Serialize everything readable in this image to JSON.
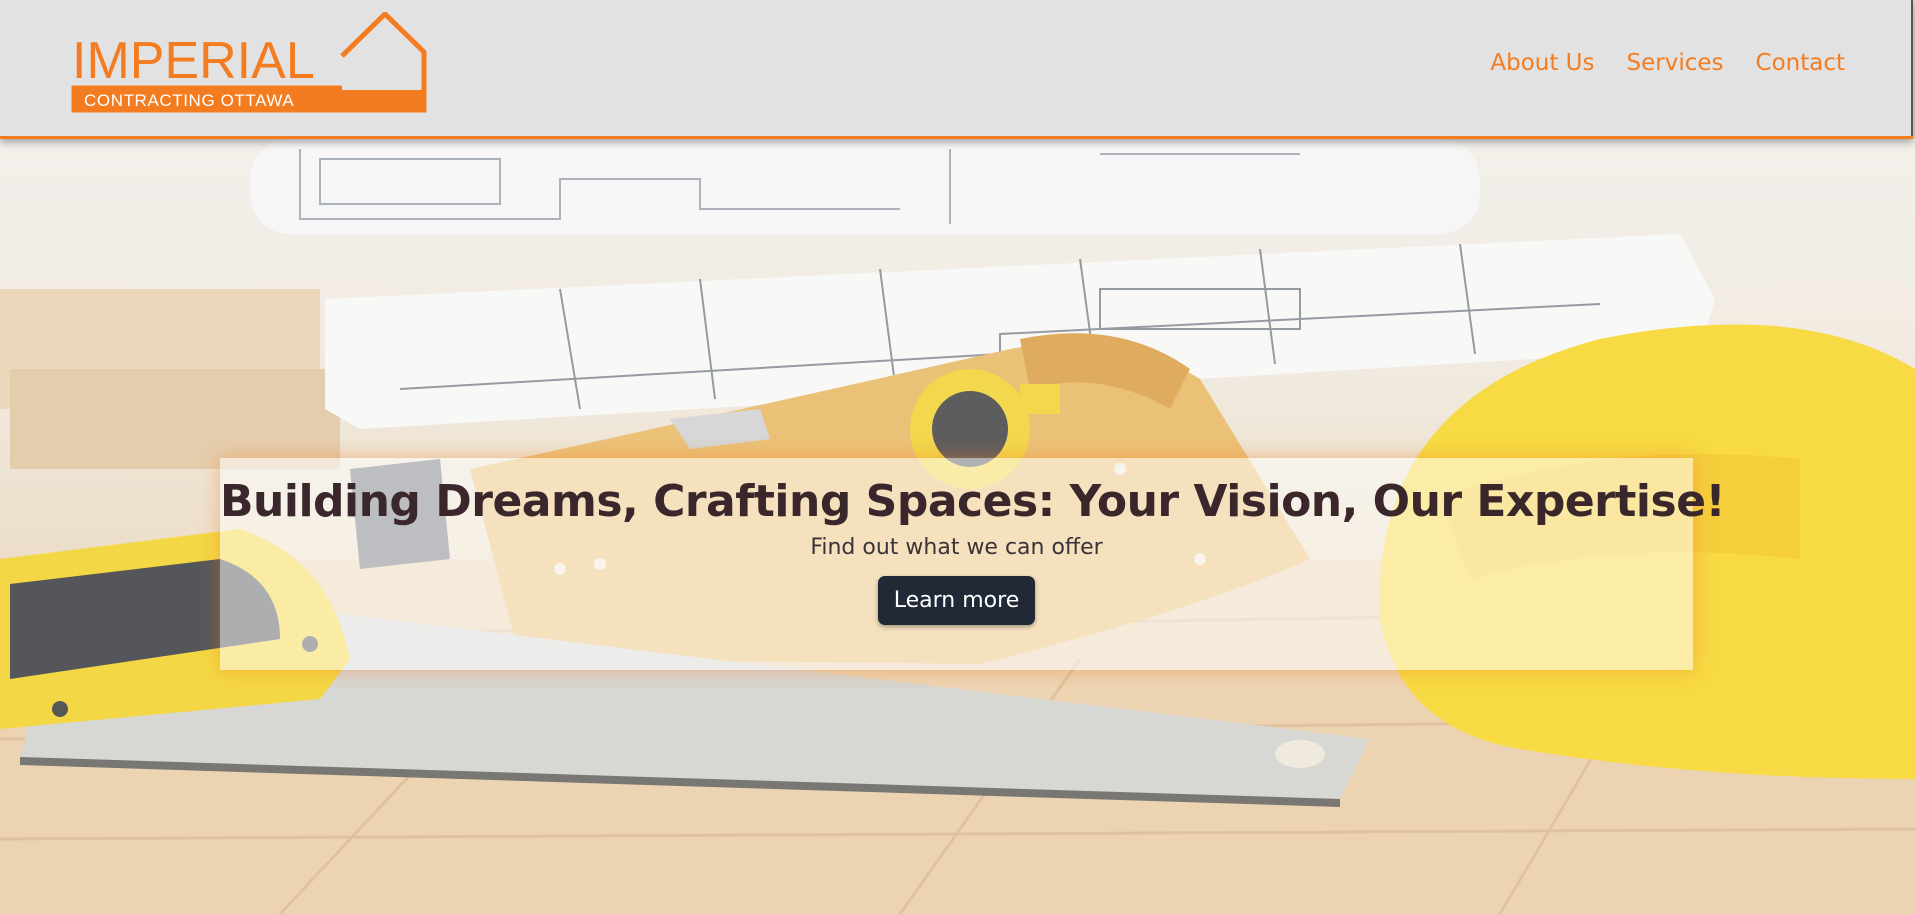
{
  "brand": {
    "name": "IMPERIAL",
    "tagline": "CONTRACTING OTTAWA",
    "accent_color": "#f47c20"
  },
  "nav": {
    "items": [
      {
        "label": "About Us"
      },
      {
        "label": "Services"
      },
      {
        "label": "Contact"
      }
    ]
  },
  "hero": {
    "title": "Building Dreams, Crafting Spaces: Your Vision, Our Expertise!",
    "subtitle": "Find out what we can offer",
    "cta_label": "Learn more",
    "cta_color": "#212936",
    "background_image": "construction-tools-photo"
  }
}
